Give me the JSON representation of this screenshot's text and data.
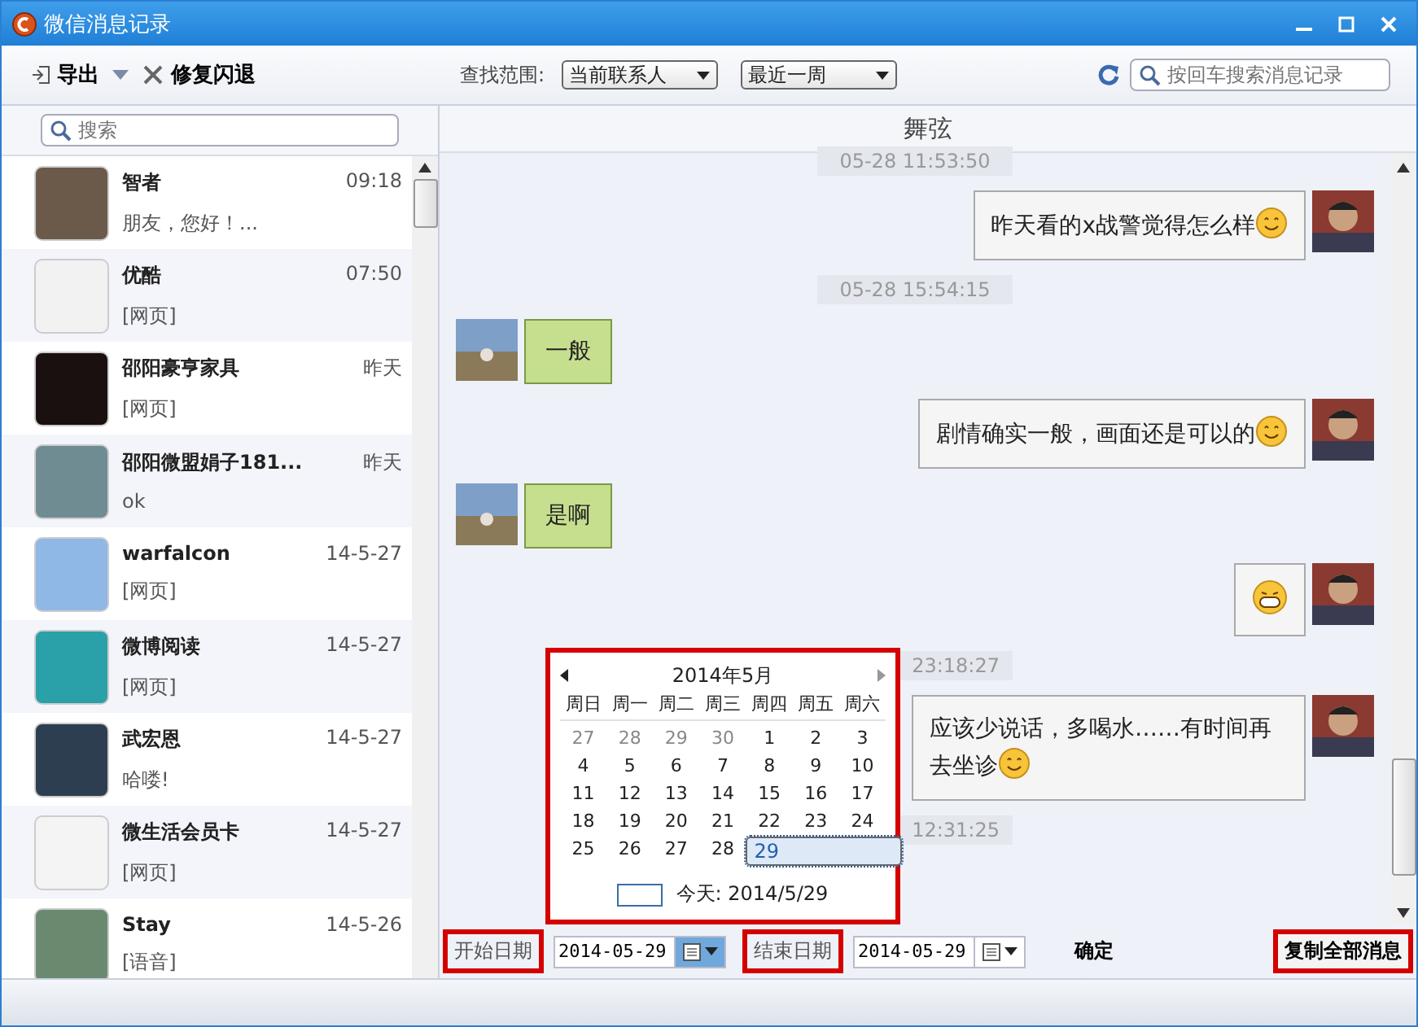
{
  "window": {
    "title": "微信消息记录"
  },
  "toolbar": {
    "export_label": "导出",
    "repair_label": "修复闪退",
    "scope_label": "查找范围:",
    "scope_value": "当前联系人",
    "period_value": "最近一周",
    "search_placeholder": "按回车搜索消息记录"
  },
  "sidebar": {
    "search_placeholder": "搜索",
    "contacts": [
      {
        "name": "智者",
        "preview": "朋友，您好！...",
        "time": "09:18"
      },
      {
        "name": "优酷",
        "preview": "[网页]",
        "time": "07:50"
      },
      {
        "name": "邵阳豪亨家具",
        "preview": "[网页]",
        "time": "昨天"
      },
      {
        "name": "邵阳微盟娟子181...",
        "preview": "ok",
        "time": "昨天"
      },
      {
        "name": "warfalcon",
        "preview": "[网页]",
        "time": "14-5-27"
      },
      {
        "name": "微博阅读",
        "preview": "[网页]",
        "time": "14-5-27"
      },
      {
        "name": "武宏恩",
        "preview": "哈喽!",
        "time": "14-5-27"
      },
      {
        "name": "微生活会员卡",
        "preview": "[网页]",
        "time": "14-5-27"
      },
      {
        "name": "Stay",
        "preview": "[语音]",
        "time": "14-5-26"
      }
    ]
  },
  "chat": {
    "title": "舞弦",
    "messages": [
      {
        "kind": "time",
        "text": "05-28 11:53:50"
      },
      {
        "kind": "outgoing",
        "text": "昨天看的x战警觉得怎么样",
        "smiley": true
      },
      {
        "kind": "time",
        "text": "05-28 15:54:15"
      },
      {
        "kind": "incoming",
        "text": "一般"
      },
      {
        "kind": "outgoing",
        "text": "剧情确实一般，画面还是可以的",
        "smiley": true
      },
      {
        "kind": "incoming",
        "text": "是啊"
      },
      {
        "kind": "sticker"
      },
      {
        "kind": "time",
        "text": "23:18:27"
      },
      {
        "kind": "outgoing",
        "text": "应该少说话，多喝水……有时间再去坐诊",
        "smiley": true
      },
      {
        "kind": "time",
        "text": "12:31:25"
      }
    ]
  },
  "date_bar": {
    "start_label": "开始日期",
    "start_value": "2014-05-29",
    "end_label": "结束日期",
    "end_value": "2014-05-29",
    "confirm_label": "确定",
    "copy_label": "复制全部消息"
  },
  "calendar": {
    "month_title": "2014年5月",
    "weekdays": [
      "周日",
      "周一",
      "周二",
      "周三",
      "周四",
      "周五",
      "周六"
    ],
    "days": [
      {
        "text": "27",
        "other_month": true,
        "selected": false
      },
      {
        "text": "28",
        "other_month": true,
        "selected": false
      },
      {
        "text": "29",
        "other_month": true,
        "selected": false
      },
      {
        "text": "30",
        "other_month": true,
        "selected": false
      },
      {
        "text": "1",
        "other_month": false,
        "selected": false
      },
      {
        "text": "2",
        "other_month": false,
        "selected": false
      },
      {
        "text": "3",
        "other_month": false,
        "selected": false
      },
      {
        "text": "4",
        "other_month": false,
        "selected": false
      },
      {
        "text": "5",
        "other_month": false,
        "selected": false
      },
      {
        "text": "6",
        "other_month": false,
        "selected": false
      },
      {
        "text": "7",
        "other_month": false,
        "selected": false
      },
      {
        "text": "8",
        "other_month": false,
        "selected": false
      },
      {
        "text": "9",
        "other_month": false,
        "selected": false
      },
      {
        "text": "10",
        "other_month": false,
        "selected": false
      },
      {
        "text": "11",
        "other_month": false,
        "selected": false
      },
      {
        "text": "12",
        "other_month": false,
        "selected": false
      },
      {
        "text": "13",
        "other_month": false,
        "selected": false
      },
      {
        "text": "14",
        "other_month": false,
        "selected": false
      },
      {
        "text": "15",
        "other_month": false,
        "selected": false
      },
      {
        "text": "16",
        "other_month": false,
        "selected": false
      },
      {
        "text": "17",
        "other_month": false,
        "selected": false
      },
      {
        "text": "18",
        "other_month": false,
        "selected": false
      },
      {
        "text": "19",
        "other_month": false,
        "selected": false
      },
      {
        "text": "20",
        "other_month": false,
        "selected": false
      },
      {
        "text": "21",
        "other_month": false,
        "selected": false
      },
      {
        "text": "22",
        "other_month": false,
        "selected": false
      },
      {
        "text": "23",
        "other_month": false,
        "selected": false
      },
      {
        "text": "24",
        "other_month": false,
        "selected": false
      },
      {
        "text": "25",
        "other_month": false,
        "selected": false
      },
      {
        "text": "26",
        "other_month": false,
        "selected": false
      },
      {
        "text": "27",
        "other_month": false,
        "selected": false
      },
      {
        "text": "28",
        "other_month": false,
        "selected": false
      },
      {
        "text": "29",
        "other_month": false,
        "selected": true
      }
    ],
    "today_label": "今天: 2014/5/29"
  }
}
